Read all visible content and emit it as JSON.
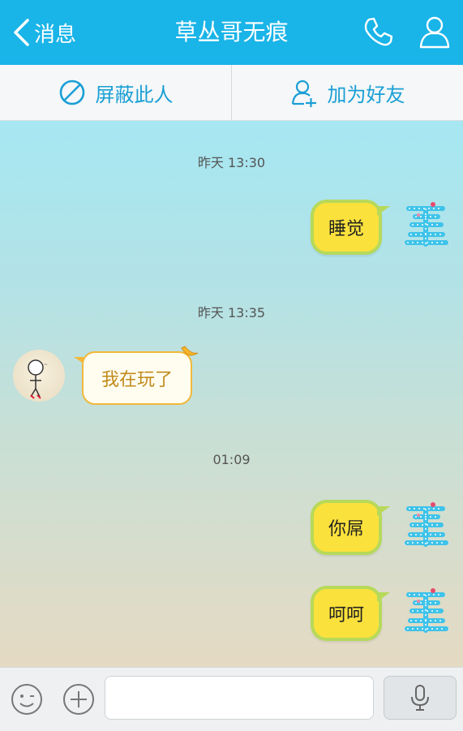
{
  "header": {
    "back_label": "消息",
    "title": "草丛哥无痕",
    "back_icon": "chevron-left-icon",
    "call_icon": "phone-icon",
    "profile_icon": "person-icon"
  },
  "actions": [
    {
      "label": "屏蔽此人",
      "icon": "block-icon"
    },
    {
      "label": "加为好友",
      "icon": "add-friend-icon"
    }
  ],
  "messages": [
    {
      "type": "timestamp",
      "text": "昨天 13:30"
    },
    {
      "type": "sent",
      "text": "睡觉"
    },
    {
      "type": "timestamp",
      "text": "昨天 13:35"
    },
    {
      "type": "received",
      "text": "我在玩了"
    },
    {
      "type": "timestamp",
      "text": "01:09"
    },
    {
      "type": "sent",
      "text": "你屌"
    },
    {
      "type": "sent",
      "text": "呵呵"
    }
  ],
  "input_bar": {
    "placeholder": "",
    "value": "",
    "emoji_icon": "emoji-icon",
    "plus_icon": "plus-icon",
    "mic_icon": "microphone-icon"
  },
  "colors": {
    "header_bg": "#19b4e8",
    "accent": "#1a9fd6",
    "sent_bubble_fill": "#fbe13c",
    "sent_bubble_border": "#b7d95a",
    "received_bubble_border": "#f2b83a"
  }
}
